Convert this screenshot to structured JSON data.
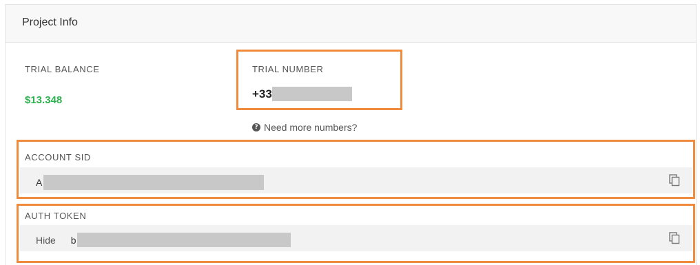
{
  "panel": {
    "title": "Project Info"
  },
  "trial_balance": {
    "label": "TRIAL BALANCE",
    "value": "$13.348"
  },
  "trial_number": {
    "label": "TRIAL NUMBER",
    "value_prefix": "+33"
  },
  "help": {
    "text": "Need more numbers?",
    "icon": "question-circle-icon"
  },
  "account_sid": {
    "label": "ACCOUNT SID",
    "value_prefix": "A",
    "copy_icon": "copy-icon"
  },
  "auth_token": {
    "label": "AUTH TOKEN",
    "hide_label": "Hide",
    "value_prefix": "b",
    "copy_icon": "copy-icon"
  },
  "colors": {
    "highlight": "#f08a3c",
    "balance": "#2eb24f",
    "redaction": "#c8c8c8"
  }
}
